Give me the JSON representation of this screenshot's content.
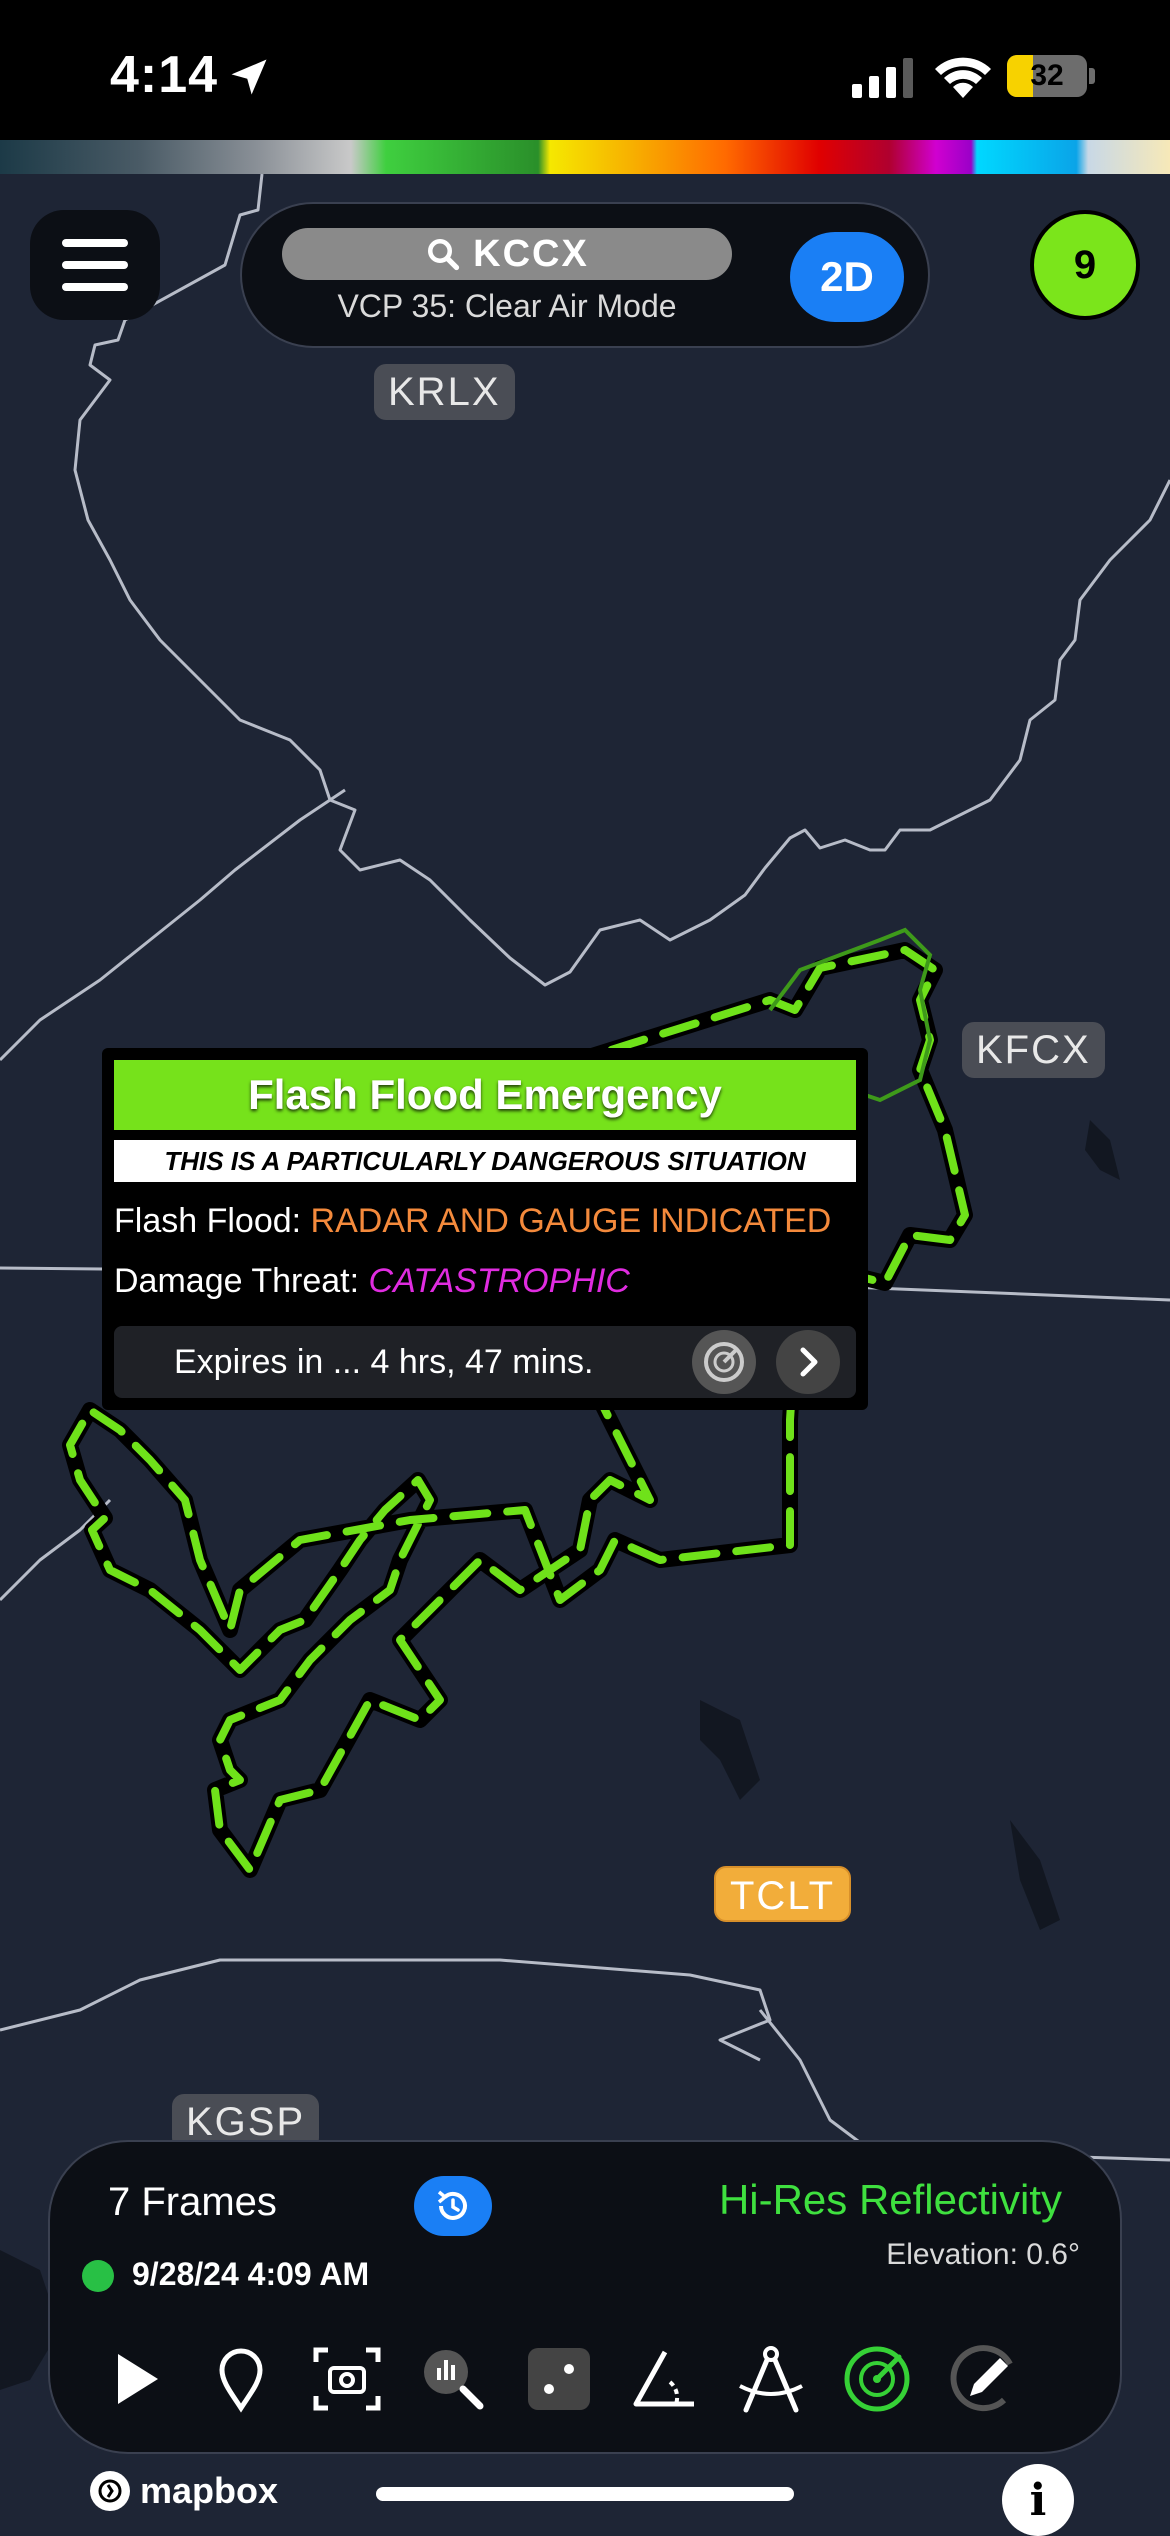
{
  "status_bar": {
    "time": "4:14",
    "battery_percent": "32",
    "battery_level": 0.32
  },
  "header": {
    "search_query": "KCCX",
    "vcp_text": "VCP 35: Clear Air Mode",
    "view_mode": "2D",
    "notification_count": "9"
  },
  "map": {
    "radar_sites": [
      "KRLX",
      "KFCX",
      "TCLT",
      "KGSP"
    ],
    "attribution": "mapbox"
  },
  "alert": {
    "title": "Flash Flood Emergency",
    "pds_text": "THIS IS A PARTICULARLY DANGEROUS SITUATION",
    "flood_label": "Flash Flood:",
    "flood_value": "RADAR AND GAUGE INDICATED",
    "damage_label": "Damage Threat:",
    "damage_value": "CATASTROPHIC",
    "expires_text": "Expires in ... 4 hrs, 47 mins.",
    "colors": {
      "header": "#76e21b",
      "flood_value": "#f48a3c",
      "damage_value": "#e02ce0"
    }
  },
  "playback": {
    "frames_label": "7 Frames",
    "timestamp": "9/28/24 4:09 AM",
    "product": "Hi-Res Reflectivity",
    "elevation": "Elevation: 0.6°"
  },
  "toolbar": {
    "tools": [
      "play-icon",
      "location-pin-icon",
      "screenshot-icon",
      "zoom-analyze-icon",
      "dice-icon",
      "ruler-angle-icon",
      "compass-icon",
      "radar-icon",
      "pencil-icon"
    ],
    "active_tool": "radar-icon"
  }
}
